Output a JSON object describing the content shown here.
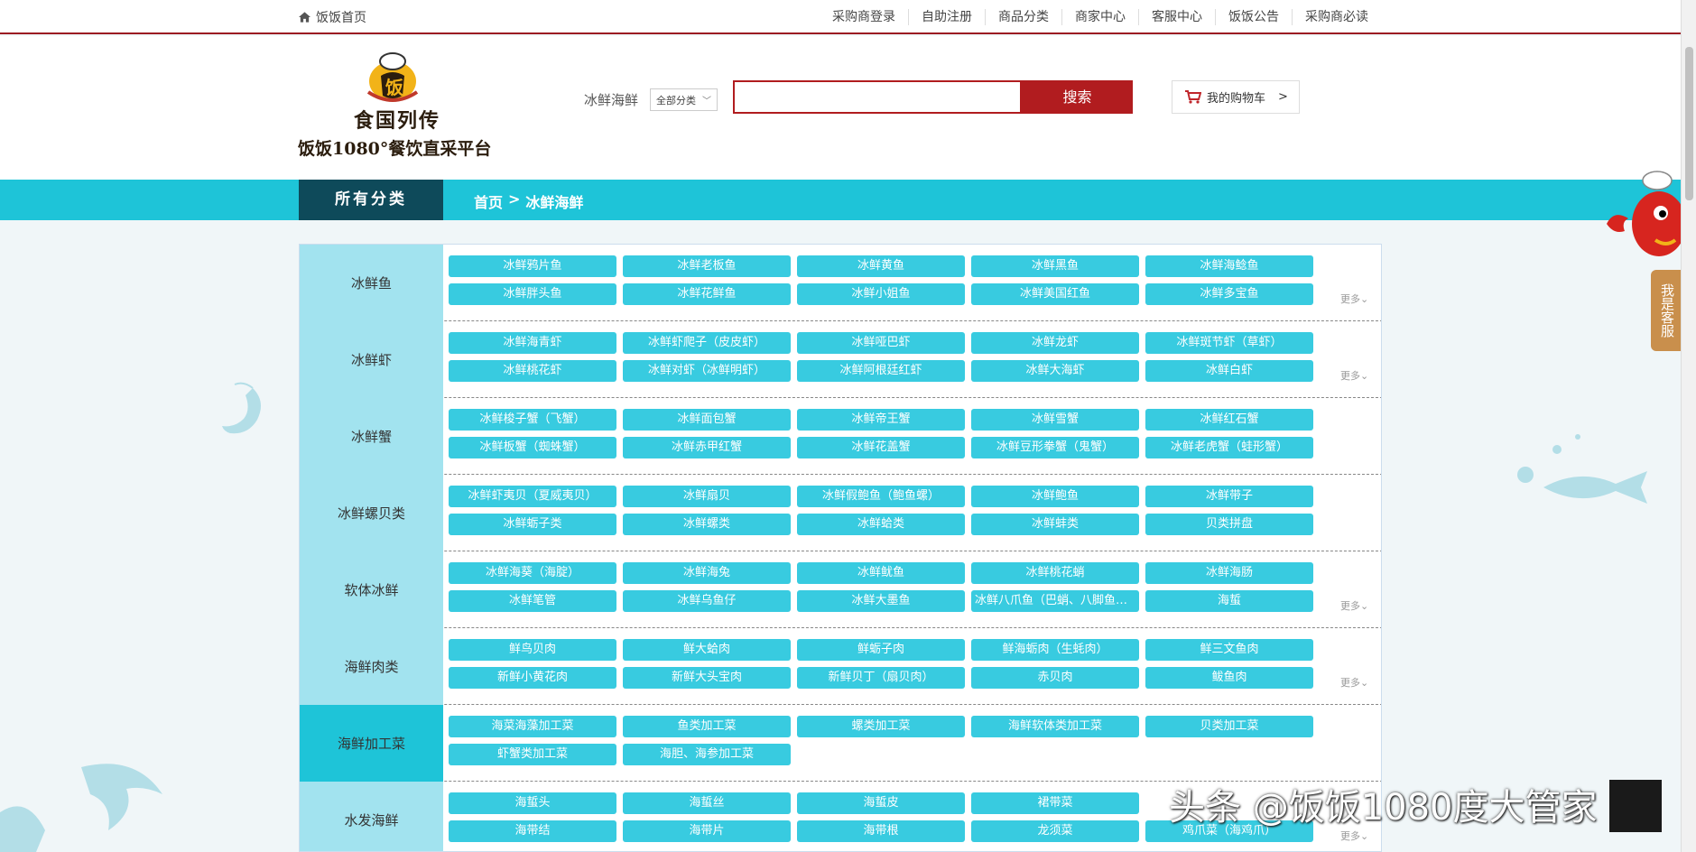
{
  "topbar": {
    "home_label": "饭饭首页",
    "nav": [
      "采购商登录",
      "自助注册",
      "商品分类",
      "商家中心",
      "客服中心",
      "饭饭公告",
      "采购商必读"
    ]
  },
  "header": {
    "logo_line1": "食国列传",
    "logo_line2": "饭饭1080°餐饮直采平台",
    "current_category": "冰鲜海鲜",
    "select_value": "全部分类",
    "search_button": "搜索",
    "cart_label": "我的购物车",
    "cart_chevron": ">"
  },
  "catbar": {
    "all_label": "所有分类",
    "crumb_home": "首页",
    "crumb_sep": ">",
    "crumb_current": "冰鲜海鲜"
  },
  "more_label": "更多",
  "rows": [
    {
      "label": "冰鲜鱼",
      "items": [
        "冰鲜鸦片鱼",
        "冰鲜老板鱼",
        "冰鲜黄鱼",
        "冰鲜黑鱼",
        "冰鲜海鲶鱼",
        "冰鲜胖头鱼",
        "冰鲜花鲜鱼",
        "冰鲜小姐鱼",
        "冰鲜美国红鱼",
        "冰鲜多宝鱼"
      ],
      "more": true
    },
    {
      "label": "冰鲜虾",
      "items": [
        "冰鲜海青虾",
        "冰鲜虾爬子（皮皮虾）",
        "冰鲜哑巴虾",
        "冰鲜龙虾",
        "冰鲜斑节虾（草虾）",
        "冰鲜桃花虾",
        "冰鲜对虾（冰鲜明虾）",
        "冰鲜阿根廷红虾",
        "冰鲜大海虾",
        "冰鲜白虾"
      ],
      "more": true
    },
    {
      "label": "冰鲜蟹",
      "items": [
        "冰鲜梭子蟹（飞蟹）",
        "冰鲜面包蟹",
        "冰鲜帝王蟹",
        "冰鲜雪蟹",
        "冰鲜红石蟹",
        "冰鲜板蟹（蜘蛛蟹）",
        "冰鲜赤甲红蟹",
        "冰鲜花盖蟹",
        "冰鲜豆形拳蟹（鬼蟹）",
        "冰鲜老虎蟹（蛙形蟹）"
      ],
      "more": false
    },
    {
      "label": "冰鲜螺贝类",
      "items": [
        "冰鲜虾夷贝（夏威夷贝）",
        "冰鲜扇贝",
        "冰鲜假鲍鱼（鲍鱼螺）",
        "冰鲜鲍鱼",
        "冰鲜带子",
        "冰鲜蛎子类",
        "冰鲜螺类",
        "冰鲜蛤类",
        "冰鲜蚌类",
        "贝类拼盘"
      ],
      "more": false
    },
    {
      "label": "软体冰鲜",
      "items": [
        "冰鲜海葵（海腚）",
        "冰鲜海兔",
        "冰鲜鱿鱼",
        "冰鲜桃花蛸",
        "冰鲜海肠",
        "冰鲜笔管",
        "冰鲜乌鱼仔",
        "冰鲜大墨鱼",
        "冰鲜八爪鱼（巴蛸、八脚鱼、章鱼）",
        "海蜇"
      ],
      "more": true
    },
    {
      "label": "海鲜肉类",
      "items": [
        "鲜鸟贝肉",
        "鲜大蛤肉",
        "鲜蛎子肉",
        "鲜海蛎肉（生蚝肉）",
        "鲜三文鱼肉",
        "新鲜小黄花肉",
        "新鲜大头宝肉",
        "新鲜贝丁（扇贝肉）",
        "赤贝肉",
        "鲅鱼肉"
      ],
      "more": true
    },
    {
      "label": "海鲜加工菜",
      "items": [
        "海菜海藻加工菜",
        "鱼类加工菜",
        "螺类加工菜",
        "海鲜软体类加工菜",
        "贝类加工菜",
        "虾蟹类加工菜",
        "海胆、海参加工菜"
      ],
      "more": false
    },
    {
      "label": "水发海鲜",
      "items": [
        "海蜇头",
        "海蜇丝",
        "海蜇皮",
        "裙带菜",
        "",
        "海带结",
        "海带片",
        "海带根",
        "龙须菜",
        "鸡爪菜（海鸡爪）"
      ],
      "more": true
    }
  ],
  "sidebar": {
    "kefu_label": "我是客服"
  },
  "watermark": "头条 @饭饭1080度大管家",
  "colors": {
    "accent": "#1ec4d8",
    "dark_teal": "#0e4a5a",
    "tag": "#38cbe0",
    "label_bg": "#a2e3ef",
    "brand_red": "#b11c1f"
  }
}
